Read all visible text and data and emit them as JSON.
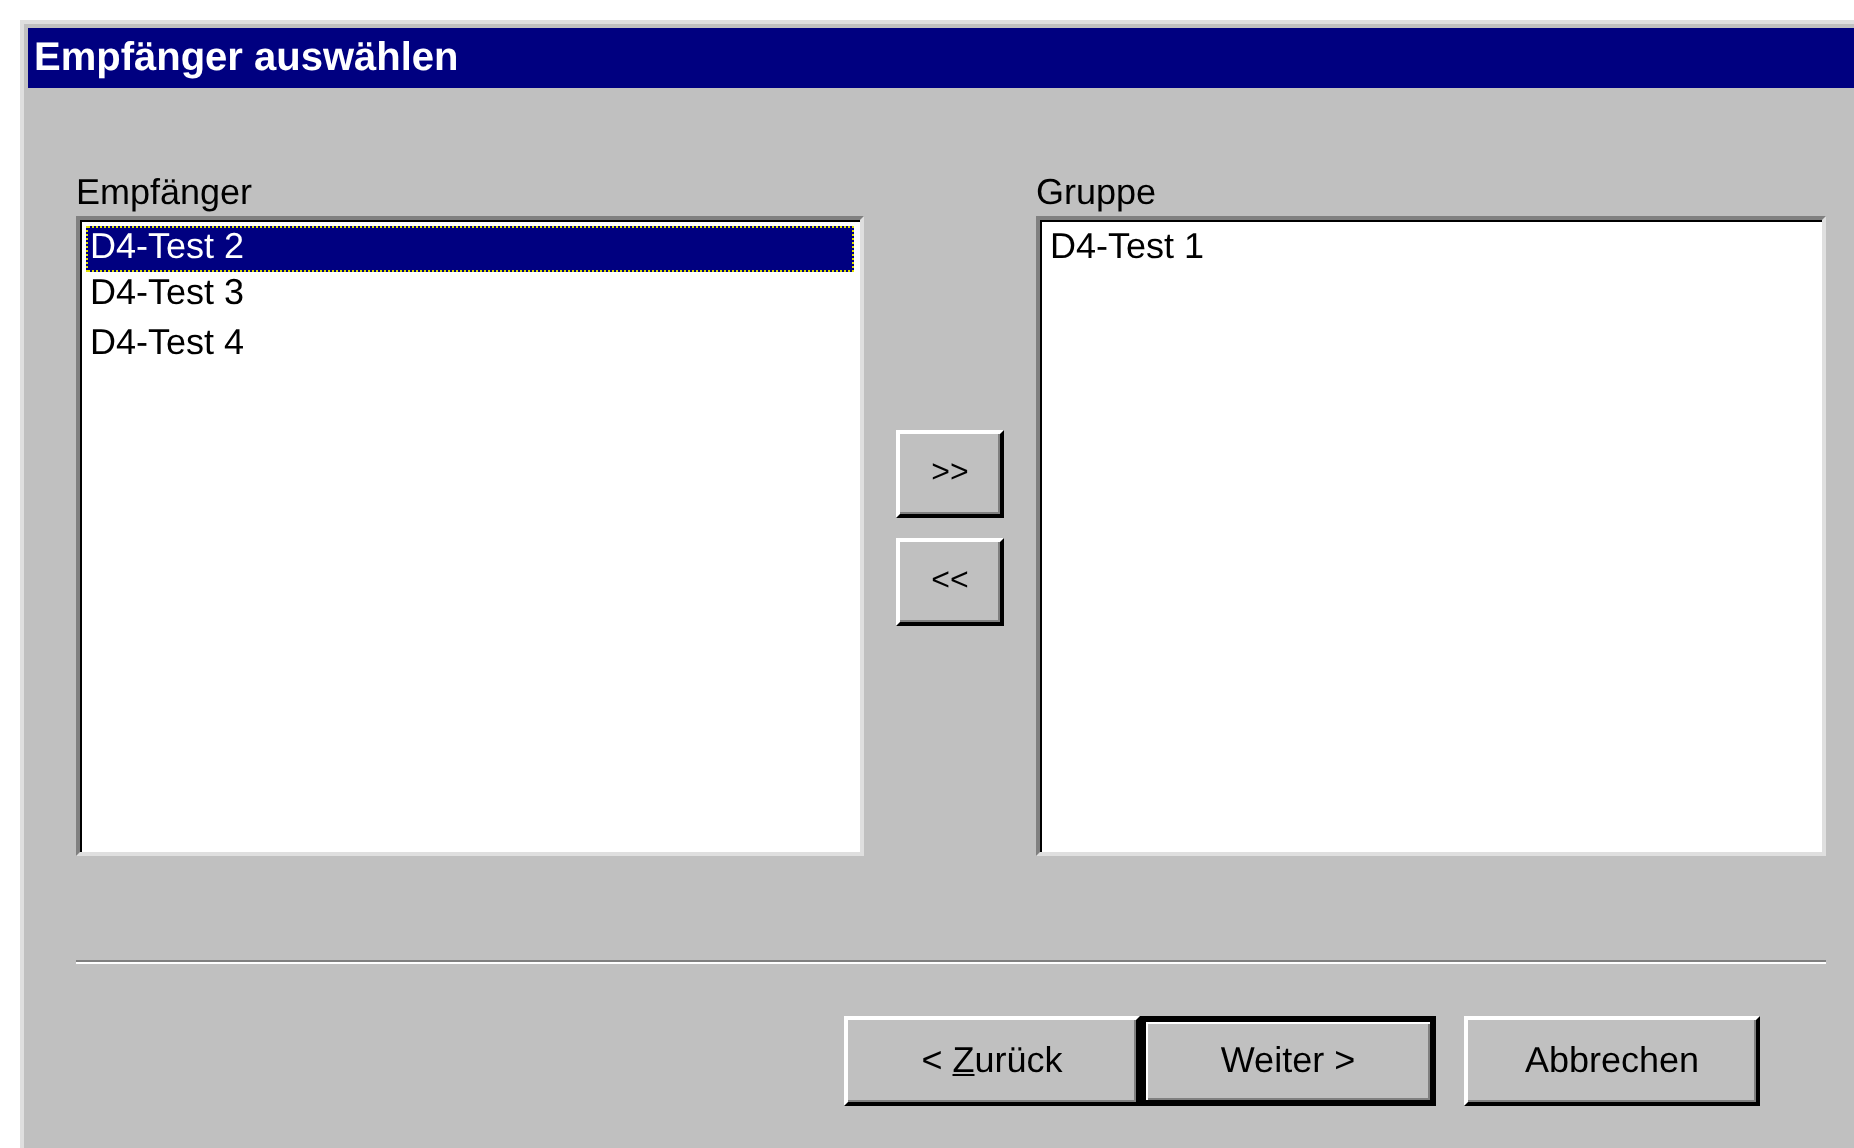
{
  "window": {
    "title": "Empfänger auswählen"
  },
  "lists": [
    {
      "label": "Empfänger",
      "items": [
        {
          "text": "D4-Test 2",
          "selected": true
        },
        {
          "text": "D4-Test 3",
          "selected": false
        },
        {
          "text": "D4-Test 4",
          "selected": false
        }
      ]
    },
    {
      "label": "Gruppe",
      "items": [
        {
          "text": "D4-Test 1",
          "selected": false
        }
      ]
    }
  ],
  "move_buttons": [
    ">>",
    "<<"
  ],
  "buttons": [
    {
      "label": {
        "before": "< ",
        "mnemonic": "Z",
        "after": "urück"
      },
      "default": false
    },
    {
      "label": {
        "before": "Weiter >"
      },
      "default": true
    },
    {
      "label": {
        "before": "Abbrechen"
      },
      "default": false
    }
  ]
}
